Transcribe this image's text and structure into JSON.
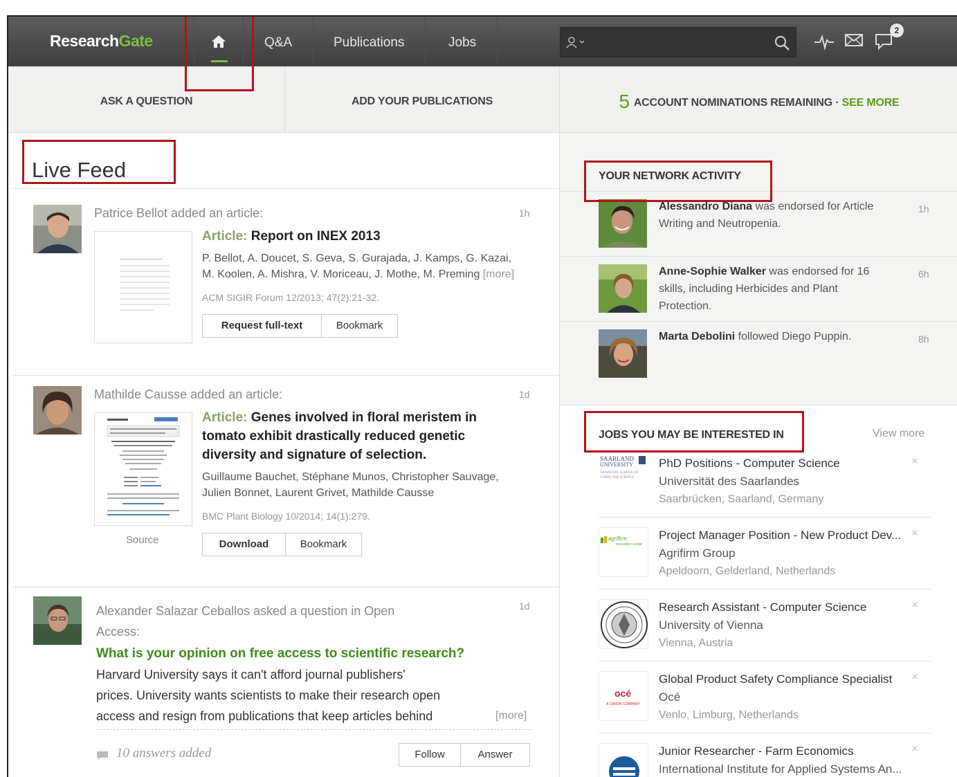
{
  "nav": {
    "logo_a": "Research",
    "logo_b": "Gate",
    "qa": "Q&A",
    "publications": "Publications",
    "jobs": "Jobs",
    "search_placeholder": "",
    "messages_badge": "2"
  },
  "actions": {
    "ask": "ASK A QUESTION",
    "add_pubs": "ADD YOUR PUBLICATIONS",
    "nominations_count": "5",
    "nominations_text": "ACCOUNT NOMINATIONS REMAINING ·",
    "see_more": "SEE MORE"
  },
  "feed": {
    "title": "Live Feed",
    "items": [
      {
        "head": "Patrice Bellot added an article:",
        "time": "1h",
        "label": "Article:",
        "title": "Report on INEX 2013",
        "authors1": "P. Bellot, A. Doucet, S. Geva, S. Gurajada, J. Kamps, G. Kazai,",
        "authors2": "M. Koolen, A. Mishra, V. Moriceau, J. Mothe, M. Preming",
        "more": "[more]",
        "journal": "ACM SIGIR Forum 12/2013; 47(2):21-32.",
        "btn1": "Request full-text",
        "btn2": "Bookmark"
      },
      {
        "head": "Mathilde Causse added an article:",
        "time": "1d",
        "label": "Article:",
        "title_l1": "Genes involved in floral meristem in",
        "title_l2": "tomato exhibit drastically reduced genetic",
        "title_l3": "diversity and signature of selection.",
        "authors1": "Guillaume Bauchet, Stéphane Munos, Christopher Sauvage,",
        "authors2": "Julien Bonnet, Laurent Grivet, Mathilde Causse",
        "journal": "BMC Plant Biology 10/2014; 14(1):279.",
        "source": "Source",
        "btn1": "Download",
        "btn2": "Bookmark"
      },
      {
        "head_l1": "Alexander Salazar Ceballos asked a question in Open",
        "head_l2": "Access:",
        "time": "1d",
        "question": "What is your opinion on free access to scientific research?",
        "body_l1": "Harvard University says it can't afford journal publishers'",
        "body_l2": "prices. University wants scientists to make their research open",
        "body_l3": "access and resign from publications that keep articles behind",
        "more": "[more]",
        "answers": "10 answers added",
        "btn1": "Follow",
        "btn2": "Answer"
      }
    ]
  },
  "network": {
    "title": "YOUR NETWORK ACTIVITY",
    "items": [
      {
        "name": "Alessandro Diana",
        "text_l1": " was endorsed for Article",
        "text_l2": "Writing and Neutropenia.",
        "time": "1h"
      },
      {
        "name": "Anne-Sophie Walker",
        "text_l1": " was endorsed for 16",
        "text_l2": "skills, including Herbicides and Plant",
        "text_l3": "Protection.",
        "time": "6h"
      },
      {
        "name": "Marta Debolini",
        "text_l1": " followed Diego Puppin.",
        "time": "8h"
      }
    ]
  },
  "jobs": {
    "title": "JOBS YOU MAY BE INTERESTED IN",
    "view_more": "View more",
    "items": [
      {
        "title": "PhD Positions - Computer Science",
        "org": "Universität des Saarlandes",
        "loc": "Saarbrücken, Saarland, Germany",
        "logo_text_1": "SAARLAND",
        "logo_text_2": "UNIVERSITY",
        "logo_text_3": "GRADUATE SCHOOL OF",
        "logo_text_4": "COMPUTER SCIENCE"
      },
      {
        "title": "Project Manager Position - New Product Dev...",
        "org": "Agrifirm Group",
        "loc": "Apeldoorn, Gelderland, Netherlands",
        "logo_text_1": "agrifirm",
        "logo_text_2": "innovation center"
      },
      {
        "title": "Research Assistant - Computer Science",
        "org": "University of Vienna",
        "loc": "Vienna, Austria"
      },
      {
        "title": "Global Product Safety Compliance Specialist",
        "org": "Océ",
        "loc": "Venlo, Limburg, Netherlands",
        "logo_text_1": "océ",
        "logo_text_2": "A CANON COMPANY"
      },
      {
        "title": "Junior Researcher - Farm Economics",
        "org": "International Institute for Applied Systems An..."
      }
    ],
    "close": "×"
  },
  "colors": {
    "brand_green": "#7cbf3e",
    "topbar": "#4a4a4a",
    "highlight_red": "#b3141b",
    "question_green": "#3f8a1c"
  }
}
